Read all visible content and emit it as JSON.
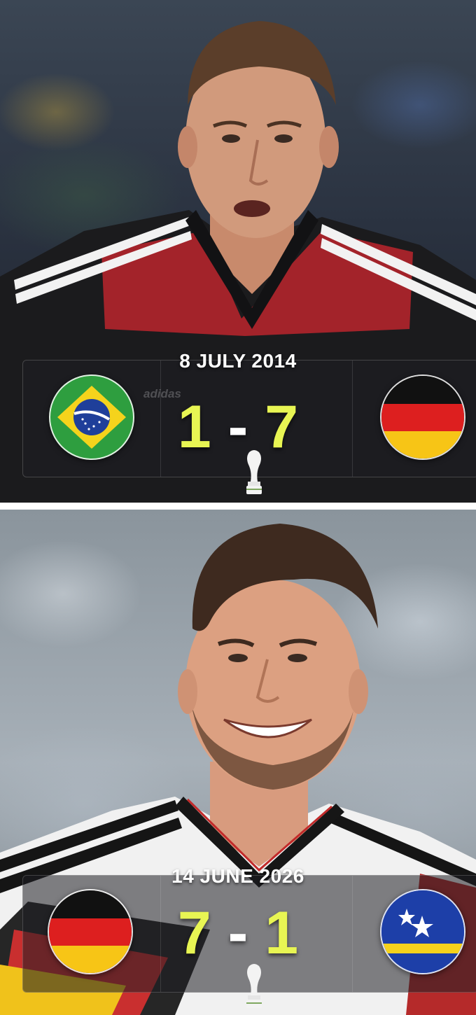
{
  "match_2014": {
    "date": "8 JULY 2014",
    "home_team_flag": "brazil-flag",
    "away_team_flag": "germany-flag",
    "home_score": "1",
    "separator": "-",
    "away_score": "7",
    "kit_brand": "adidas"
  },
  "match_2026": {
    "date": "14 JUNE 2026",
    "home_team_flag": "germany-flag",
    "away_team_flag": "curacao-flag",
    "home_score": "7",
    "separator": "-",
    "away_score": "1"
  },
  "colors": {
    "score_yellow": "#e8f553",
    "brazil_green": "#2e9e3f",
    "brazil_yellow": "#f5d31c",
    "brazil_blue": "#1f3f9a",
    "germany_black": "#111111",
    "germany_red": "#dd1f1f",
    "germany_gold": "#f7c516",
    "curacao_blue": "#1d3fa8",
    "curacao_yellow": "#f6d21c"
  }
}
